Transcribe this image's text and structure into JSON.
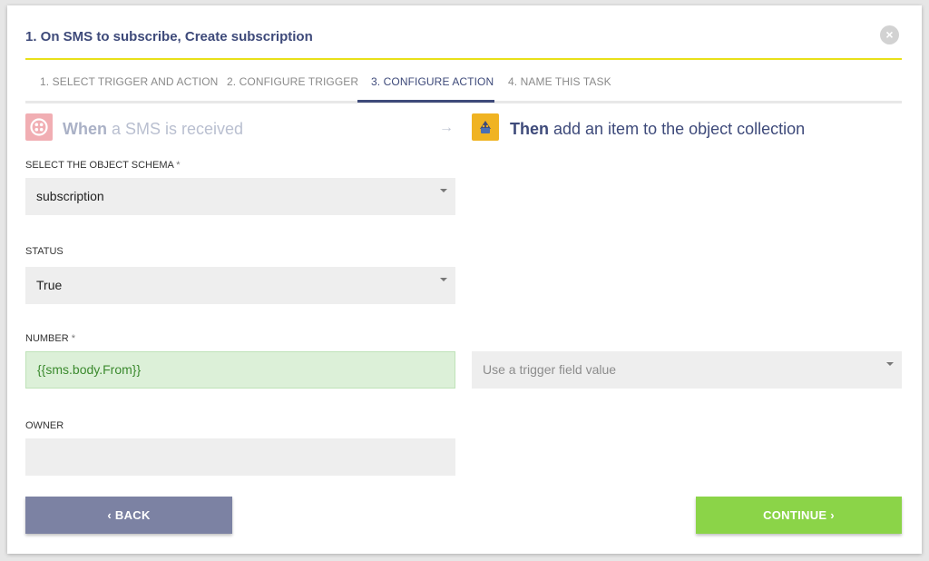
{
  "dialog": {
    "title": "1. On SMS to subscribe, Create subscription",
    "close_icon": "×"
  },
  "tabs": [
    {
      "label": "1. SELECT TRIGGER AND ACTION",
      "active": false
    },
    {
      "label": "2. CONFIGURE TRIGGER",
      "active": false
    },
    {
      "label": "3. CONFIGURE ACTION",
      "active": true
    },
    {
      "label": "4. NAME THIS TASK",
      "active": false
    }
  ],
  "flow": {
    "trigger_icon": "twilio-icon",
    "trigger_strong": "When",
    "trigger_rest": " a SMS is received",
    "arrow": "→",
    "action_icon": "object-collection-icon",
    "action_strong": "Then",
    "action_rest": " add an item to the object collection"
  },
  "form": {
    "schema": {
      "label": "SELECT THE OBJECT SCHEMA",
      "required": "*",
      "value": "subscription"
    },
    "status": {
      "label": "STATUS",
      "value": "True"
    },
    "number": {
      "label": "NUMBER",
      "required": "*",
      "value": "{{sms.body.From}}",
      "trigger_placeholder": "Use a trigger field value"
    },
    "owner": {
      "label": "OWNER",
      "value": ""
    }
  },
  "buttons": {
    "back": "‹  BACK",
    "continue": "CONTINUE  ›"
  },
  "colors": {
    "accent": "#3e4a7a",
    "title_rule": "#e8e01a",
    "back_button": "#7c82a3",
    "continue_button": "#8bd448",
    "twilio": "#f1aeb3",
    "object_icon": "#f0b322"
  }
}
